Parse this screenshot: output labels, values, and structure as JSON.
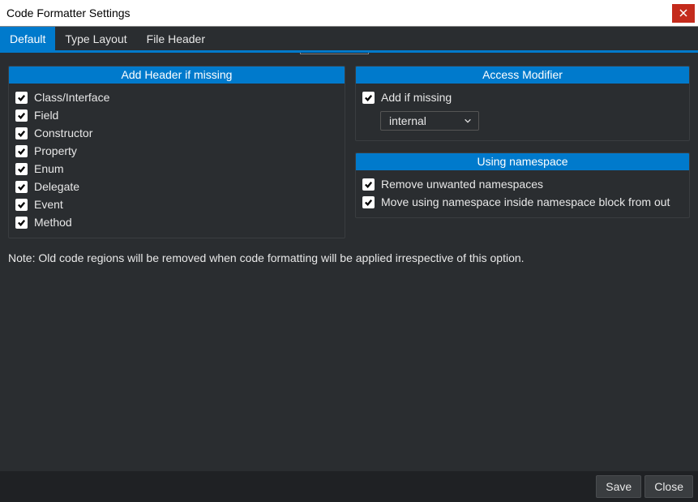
{
  "window": {
    "title": "Code Formatter Settings"
  },
  "tabs": {
    "default": "Default",
    "typeLayout": "Type Layout",
    "fileHeader": "File Header"
  },
  "addHeader": {
    "title": "Add Header if missing",
    "items": {
      "classInterface": "Class/Interface",
      "field": "Field",
      "constructor": "Constructor",
      "property": "Property",
      "enum": "Enum",
      "delegate": "Delegate",
      "event": "Event",
      "method": "Method"
    }
  },
  "accessModifier": {
    "title": "Access Modifier",
    "addIfMissing": "Add if missing",
    "selected": "internal"
  },
  "usingNamespace": {
    "title": "Using namespace",
    "removeUnwanted": "Remove unwanted namespaces",
    "moveInside": "Move using namespace inside namespace block from out"
  },
  "note": "Note: Old code regions will be removed when code formatting will be applied irrespective of this option.",
  "buttons": {
    "save": "Save",
    "close": "Close"
  }
}
